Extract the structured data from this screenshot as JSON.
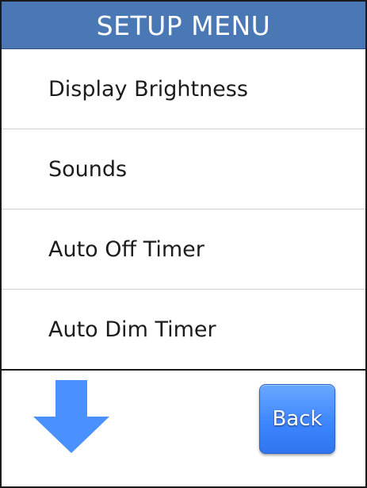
{
  "header": {
    "title": "SETUP MENU"
  },
  "menu": {
    "items": [
      {
        "label": "Display Brightness"
      },
      {
        "label": "Sounds"
      },
      {
        "label": "Auto Off Timer"
      },
      {
        "label": "Auto Dim Timer"
      }
    ]
  },
  "footer": {
    "scroll_icon": "arrow-down-icon",
    "back_label": "Back"
  },
  "colors": {
    "header_bg": "#4a78b4",
    "arrow": "#4a90ff",
    "button_bg": "#3d86ff"
  }
}
